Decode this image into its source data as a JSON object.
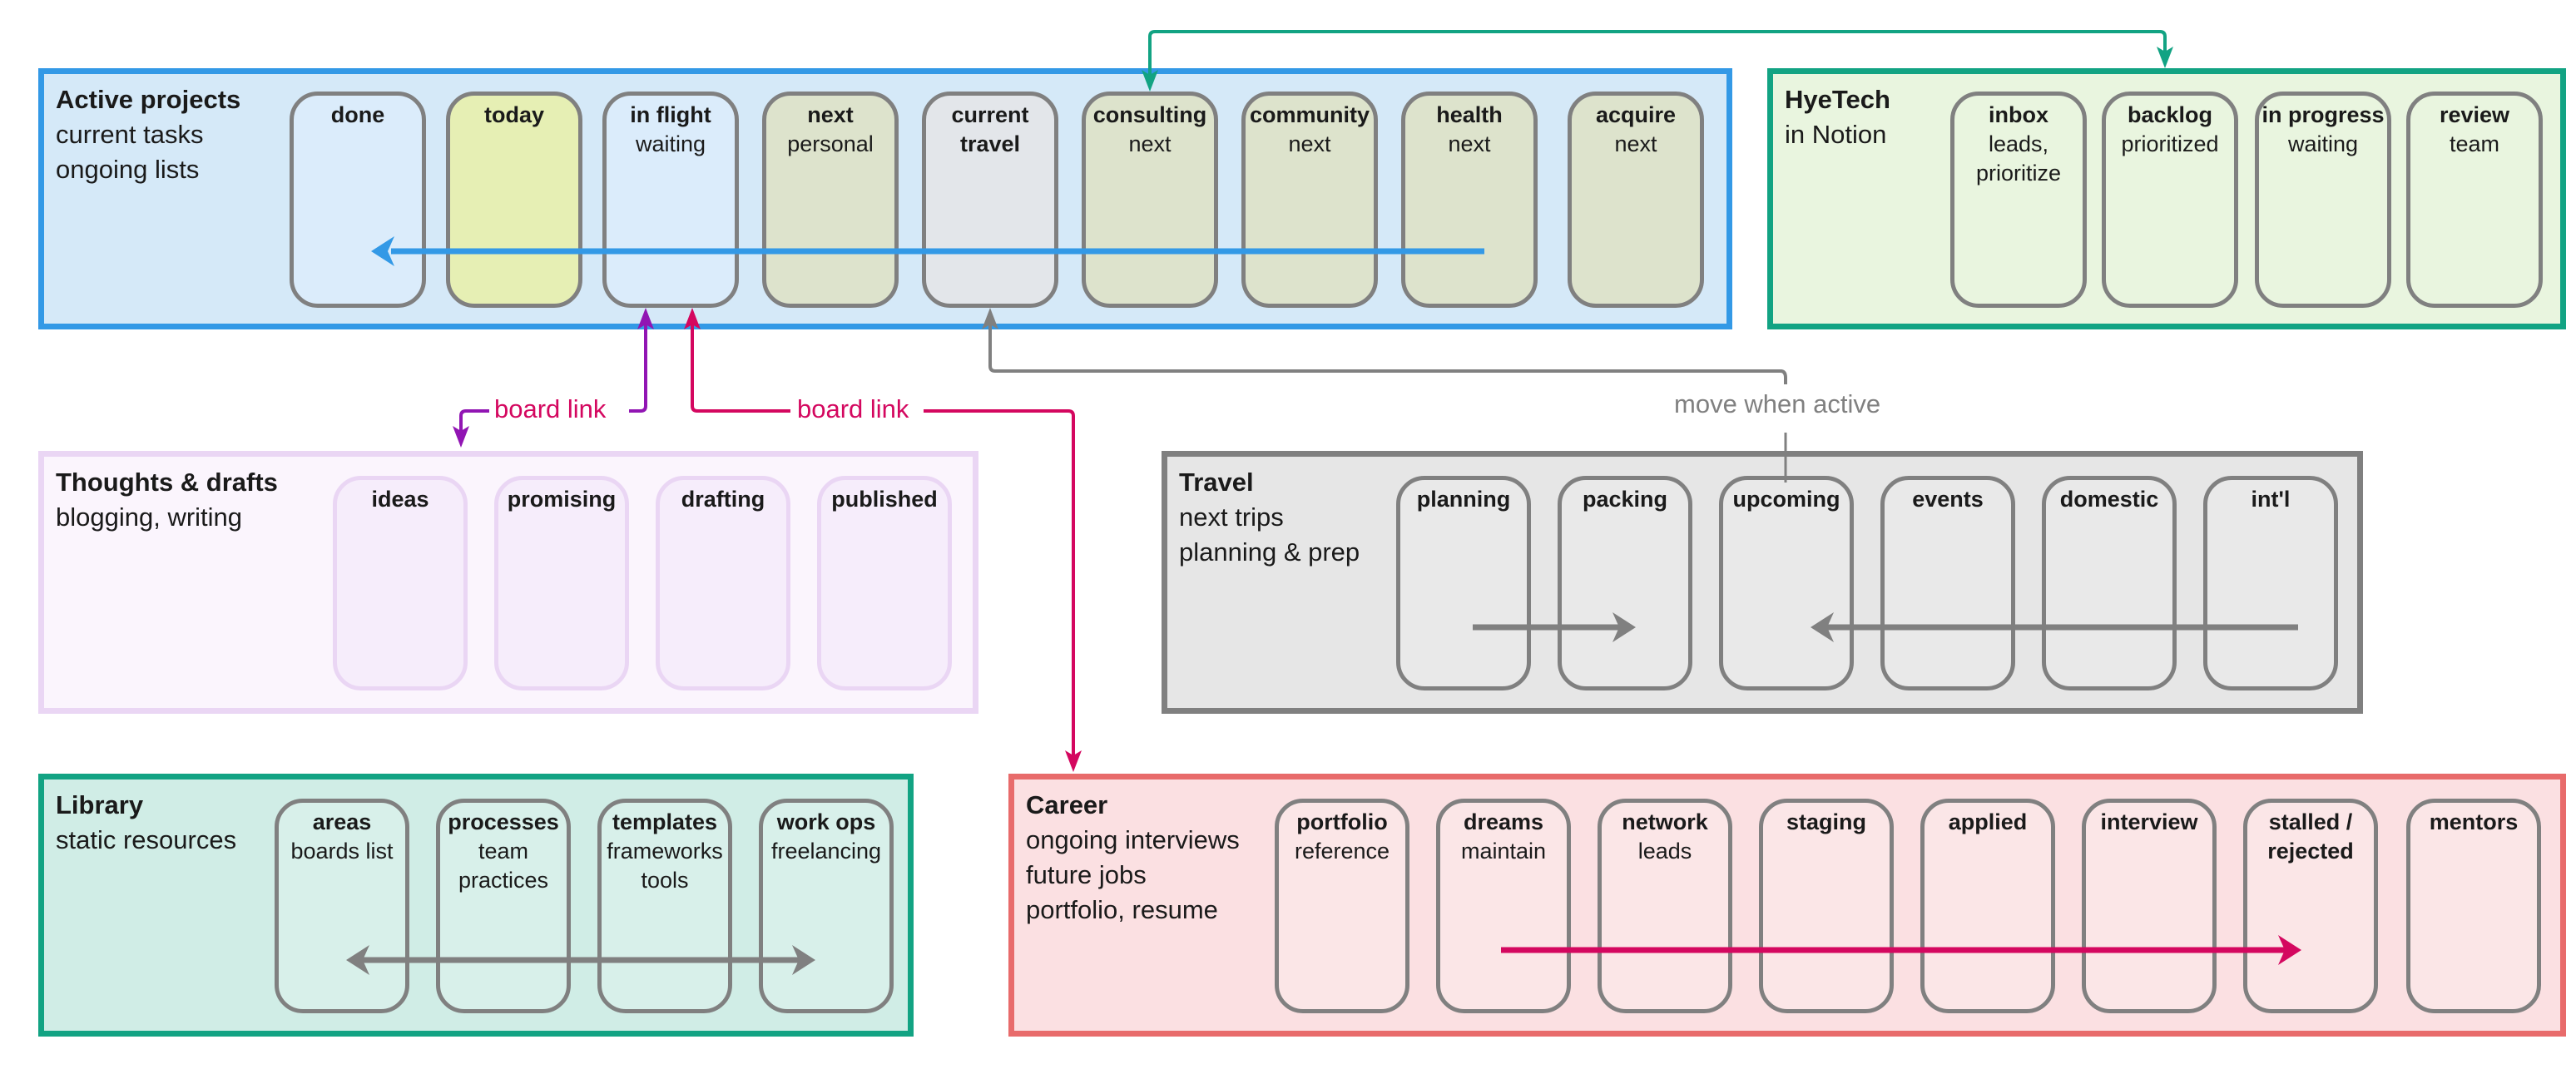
{
  "colors": {
    "active_border": "#3399e6",
    "active_fill": "#d5e9f8",
    "hyetech_border": "#12a383",
    "hyetech_fill": "#e9f5df",
    "thoughts_border": "#ead6f4",
    "thoughts_fill": "#fbf5fd",
    "travel_border": "#808080",
    "travel_fill": "#e6e6e6",
    "library_border": "#12a383",
    "library_fill": "#d0ede6",
    "career_border": "#e86b6b",
    "career_fill": "#fbe0e2",
    "link_purple": "#9115b3",
    "link_magenta": "#d4075f",
    "link_teal": "#12a383",
    "link_gray": "#808080",
    "link_blue": "#3399e6"
  },
  "boards": {
    "active": {
      "name": "Active projects",
      "subtitle": [
        "current tasks",
        "ongoing lists"
      ],
      "columns": [
        {
          "name": "done",
          "sub": "",
          "fill": "#dbecfb"
        },
        {
          "name": "today",
          "sub": "",
          "fill": "#e6efb4"
        },
        {
          "name": "in flight",
          "sub": "waiting",
          "fill": "#dbecfb"
        },
        {
          "name": "next",
          "sub": "personal",
          "fill": "#dde3cc"
        },
        {
          "name": "current\ntravel",
          "sub": "",
          "fill": "#e3e6ea"
        },
        {
          "name": "consulting",
          "sub": "next",
          "fill": "#dde3cc"
        },
        {
          "name": "community",
          "sub": "next",
          "fill": "#dde3cc"
        },
        {
          "name": "health",
          "sub": "next",
          "fill": "#dde3cc"
        },
        {
          "name": "acquire",
          "sub": "next",
          "fill": "#dde3cc"
        }
      ]
    },
    "hyetech": {
      "name": "HyeTech",
      "subtitle": [
        "in Notion"
      ],
      "columns": [
        {
          "name": "inbox",
          "sub": "leads,\nprioritize"
        },
        {
          "name": "backlog",
          "sub": "prioritized"
        },
        {
          "name": "in progress",
          "sub": "waiting"
        },
        {
          "name": "review",
          "sub": "team"
        }
      ]
    },
    "thoughts": {
      "name": "Thoughts & drafts",
      "subtitle": [
        "blogging, writing"
      ],
      "columns": [
        {
          "name": "ideas",
          "sub": ""
        },
        {
          "name": "promising",
          "sub": ""
        },
        {
          "name": "drafting",
          "sub": ""
        },
        {
          "name": "published",
          "sub": ""
        }
      ]
    },
    "travel": {
      "name": "Travel",
      "subtitle": [
        "next trips",
        "planning & prep"
      ],
      "columns": [
        {
          "name": "planning",
          "sub": ""
        },
        {
          "name": "packing",
          "sub": ""
        },
        {
          "name": "upcoming",
          "sub": ""
        },
        {
          "name": "events",
          "sub": ""
        },
        {
          "name": "domestic",
          "sub": ""
        },
        {
          "name": "int'l",
          "sub": ""
        }
      ]
    },
    "library": {
      "name": "Library",
      "subtitle": [
        "static resources"
      ],
      "columns": [
        {
          "name": "areas",
          "sub": "boards list"
        },
        {
          "name": "processes",
          "sub": "team\npractices"
        },
        {
          "name": "templates",
          "sub": "frameworks\ntools"
        },
        {
          "name": "work ops",
          "sub": "freelancing"
        }
      ]
    },
    "career": {
      "name": "Career",
      "subtitle": [
        "ongoing interviews",
        "future jobs",
        "portfolio, resume"
      ],
      "columns": [
        {
          "name": "portfolio",
          "sub": "reference"
        },
        {
          "name": "dreams",
          "sub": "maintain"
        },
        {
          "name": "network",
          "sub": "leads"
        },
        {
          "name": "staging",
          "sub": ""
        },
        {
          "name": "applied",
          "sub": ""
        },
        {
          "name": "interview",
          "sub": ""
        },
        {
          "name": "stalled /\nrejected",
          "sub": ""
        },
        {
          "name": "mentors",
          "sub": ""
        }
      ]
    }
  },
  "connectors": {
    "board_link_thoughts": "board link",
    "board_link_career": "board link",
    "move_when_active": "move when active"
  }
}
